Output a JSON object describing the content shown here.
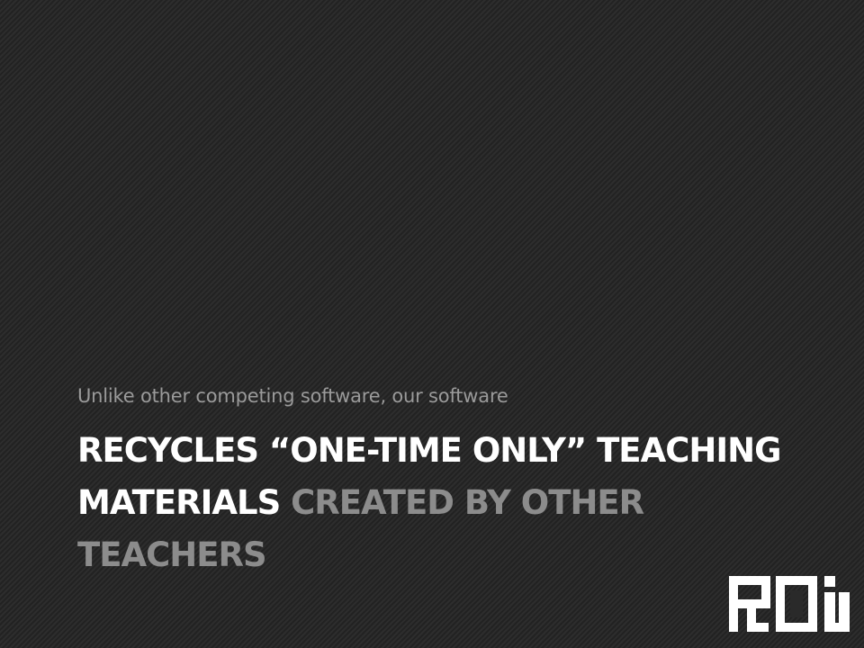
{
  "slide": {
    "subtitle": "Unlike other competing software, our software",
    "headline_line1": "RECYCLES “ONE-TIME ONLY” TEACHING",
    "headline_line2_white": "MATERIALS",
    "headline_line2_grey": "CREATED BY OTHER",
    "headline_line3_grey": "TEACHERS",
    "logo_icon": "poi-logo-icon"
  },
  "colors": {
    "background": "#2a2a2a",
    "headline_white": "#ffffff",
    "headline_grey": "#8c8c8c",
    "subtitle": "#9a9a9a"
  }
}
